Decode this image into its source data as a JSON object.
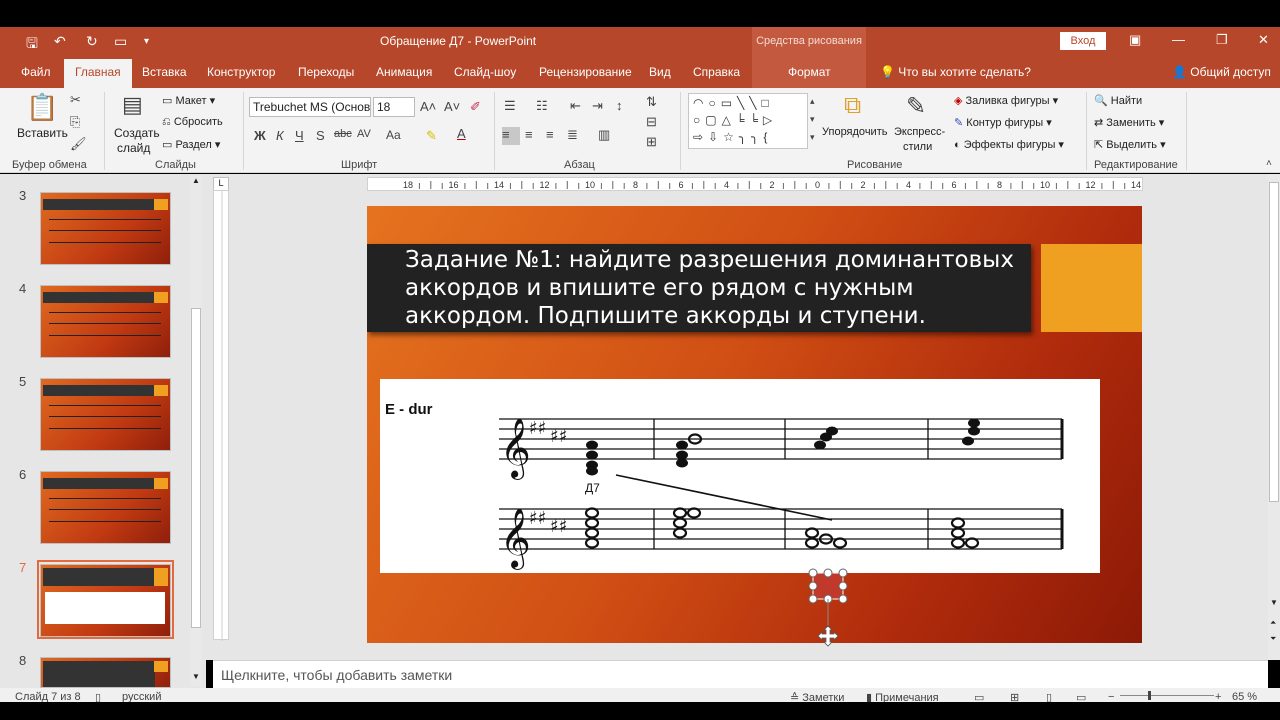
{
  "app": {
    "title": "Обращение Д7  -  PowerPoint",
    "context_tab_group": "Средства рисования",
    "login_button": "Вход"
  },
  "tabs": [
    {
      "label": "Файл"
    },
    {
      "label": "Главная"
    },
    {
      "label": "Вставка"
    },
    {
      "label": "Конструктор"
    },
    {
      "label": "Переходы"
    },
    {
      "label": "Анимация"
    },
    {
      "label": "Слайд-шоу"
    },
    {
      "label": "Рецензирование"
    },
    {
      "label": "Вид"
    },
    {
      "label": "Справка"
    },
    {
      "label": "Формат"
    }
  ],
  "tell_me": "Что вы хотите сделать?",
  "share": "Общий доступ",
  "ribbon": {
    "clipboard": {
      "paste": "Вставить",
      "label": "Буфер обмена"
    },
    "slides": {
      "new_slide_1": "Создать",
      "new_slide_2": "слайд",
      "layout": "Макет",
      "reset": "Сбросить",
      "section": "Раздел",
      "label": "Слайды"
    },
    "font": {
      "font_name": "Trebuchet MS (Основ",
      "font_size": "18",
      "bold": "Ж",
      "italic": "К",
      "underline": "Ч",
      "strike": "S",
      "shadow": "abc",
      "spacing": "AV",
      "case": "Aa",
      "label": "Шрифт"
    },
    "paragraph": {
      "label": "Абзац"
    },
    "drawing": {
      "arrange_1": "Упорядочить",
      "quick_styles_1": "Экспресс-",
      "quick_styles_2": "стили",
      "fill": "Заливка фигуры",
      "outline": "Контур фигуры",
      "effects": "Эффекты фигуры",
      "label": "Рисование"
    },
    "editing": {
      "find": "Найти",
      "replace": "Заменить",
      "select": "Выделить",
      "label": "Редактирование"
    }
  },
  "thumbnails": [
    {
      "num": "3"
    },
    {
      "num": "4"
    },
    {
      "num": "5"
    },
    {
      "num": "6"
    },
    {
      "num": "7"
    },
    {
      "num": "8"
    }
  ],
  "ruler_labels": [
    "18",
    "16",
    "14",
    "12",
    "10",
    "8",
    "6",
    "4",
    "2",
    "0",
    "2",
    "4",
    "6",
    "8",
    "10",
    "12",
    "14"
  ],
  "slide": {
    "title": "Задание №1: найдите разрешения доминантовых аккордов и впишите его рядом с нужным аккордом. Подпишите аккорды и ступени.",
    "key_label": "E - dur",
    "chord_label": "Д7"
  },
  "notes_placeholder": "Щелкните, чтобы добавить заметки",
  "status": {
    "slide_of": "Слайд 7 из 8",
    "language": "русский",
    "notes": "Заметки",
    "comments": "Примечания",
    "zoom": "65 %"
  },
  "colors": {
    "accent": "#b7472a",
    "slide_orange": "#e5731f",
    "slide_dark_red": "#8c1a06",
    "title_box": "#222222",
    "accent_block": "#f0a020"
  }
}
